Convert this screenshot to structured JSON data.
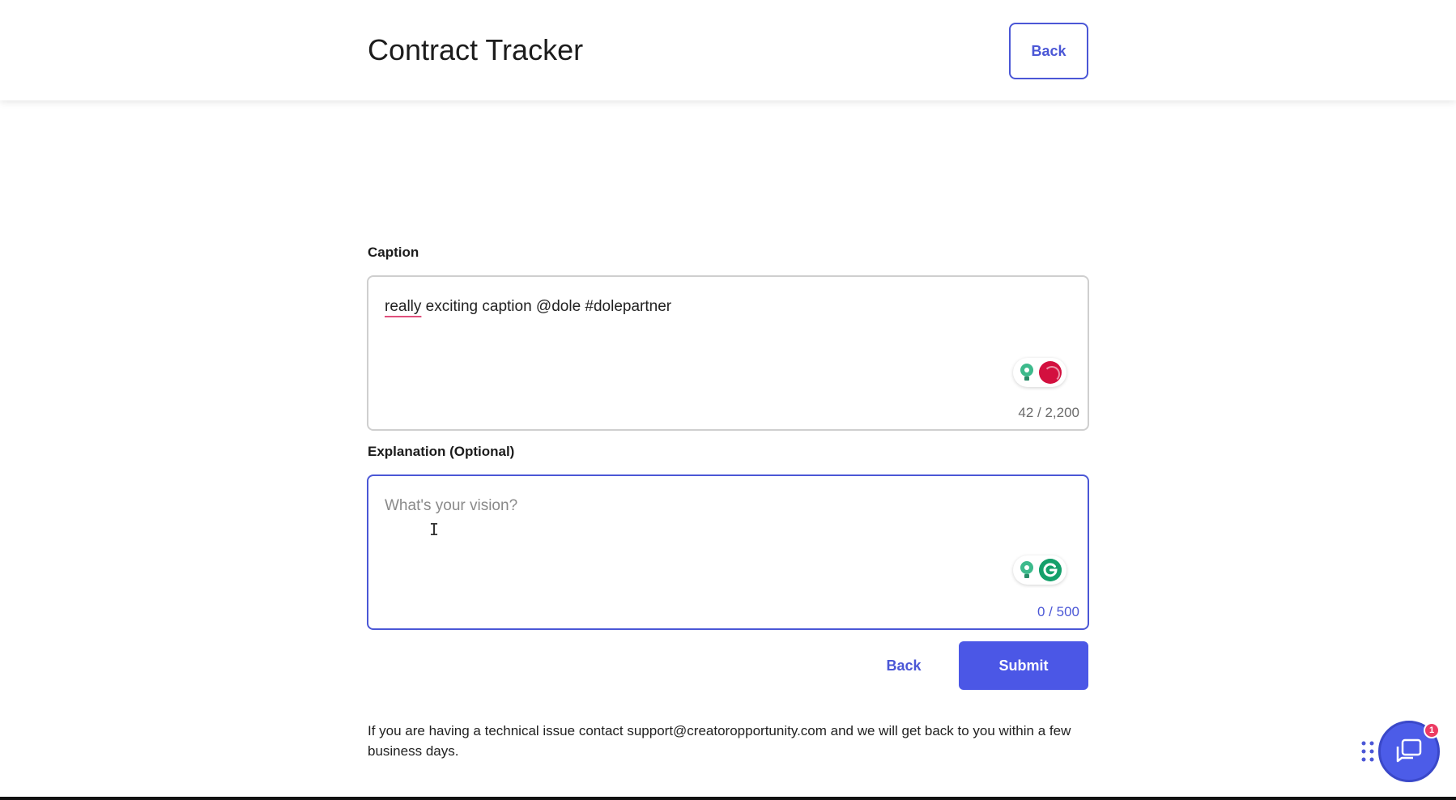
{
  "header": {
    "title": "Contract Tracker",
    "back_label": "Back"
  },
  "caption": {
    "label": "Caption",
    "first_word": "really",
    "rest_text": " exciting caption @dole #dolepartner",
    "char_count": "42 / 2,200"
  },
  "explanation": {
    "label": "Explanation (Optional)",
    "placeholder": "What's your vision?",
    "char_count": "0 / 500"
  },
  "actions": {
    "back_label": "Back",
    "submit_label": "Submit"
  },
  "footer": {
    "help_text": "If you are having a technical issue contact support@creatoropportunity.com and we will get back to you within a few business days."
  },
  "chat": {
    "badge_count": "1"
  },
  "colors": {
    "accent": "#4b57d6",
    "submit_bg": "#4b57e6",
    "badge": "#ec3b63",
    "grammarly_green": "#15a06b",
    "grammarly_red": "#d3103f"
  },
  "icons": {
    "cursor": "text-cursor-icon",
    "chat": "chat-icon",
    "grid": "grid-dots-icon",
    "suggestion": "lightbulb-icon"
  }
}
